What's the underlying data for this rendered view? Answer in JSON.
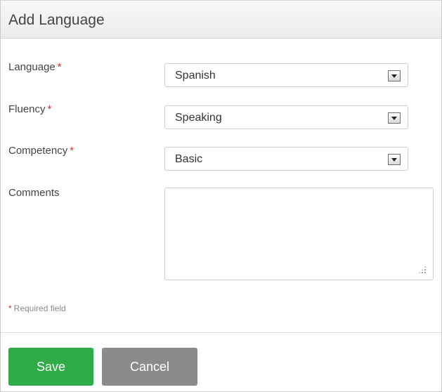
{
  "dialog": {
    "title": "Add Language"
  },
  "form": {
    "required_marker": "*",
    "language": {
      "label": "Language",
      "value": "Spanish"
    },
    "fluency": {
      "label": "Fluency",
      "value": "Speaking"
    },
    "competency": {
      "label": "Competency",
      "value": "Basic"
    },
    "comments": {
      "label": "Comments",
      "value": ""
    },
    "required_note": "Required field"
  },
  "actions": {
    "save_label": "Save",
    "cancel_label": "Cancel"
  },
  "colors": {
    "save_button": "#2fac48",
    "cancel_button": "#8b8b8b",
    "required_star": "#cc3333"
  },
  "icons": {
    "select_arrow": "chevron-down-icon",
    "resize_grip": "resize-grip-icon"
  }
}
